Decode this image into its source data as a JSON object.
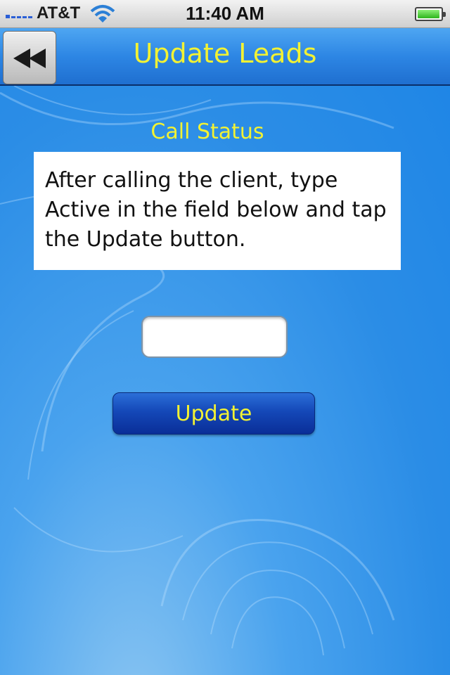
{
  "status_bar": {
    "carrier": "AT&T",
    "time": "11:40 AM",
    "battery_level": 0.9
  },
  "nav": {
    "title": "Update Leads",
    "back_icon": "rewind-icon"
  },
  "call_status": {
    "label": "Call Status",
    "instruction": "After calling the client, type Active in the field below and tap the Update button.",
    "input_value": "",
    "input_placeholder": ""
  },
  "actions": {
    "update_label": "Update"
  },
  "colors": {
    "accent_text": "#f2f233",
    "nav_blue": "#2d86e4",
    "button_blue": "#1448b8"
  }
}
